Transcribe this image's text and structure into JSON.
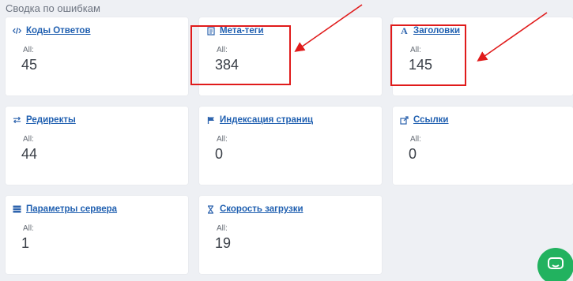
{
  "section_title": "Сводка по ошибкам",
  "cards": [
    {
      "title": "Коды Ответов",
      "all_label": "All:",
      "value": "45",
      "icon": "code-icon"
    },
    {
      "title": "Мета-теги",
      "all_label": "All:",
      "value": "384",
      "icon": "document-icon"
    },
    {
      "title": "Заголовки",
      "all_label": "All:",
      "value": "145",
      "icon": "heading-icon"
    },
    {
      "title": "Редиректы",
      "all_label": "All:",
      "value": "44",
      "icon": "redirect-arrows-icon"
    },
    {
      "title": "Индексация страниц",
      "all_label": "All:",
      "value": "0",
      "icon": "flag-icon"
    },
    {
      "title": "Ссылки",
      "all_label": "All:",
      "value": "0",
      "icon": "external-link-icon"
    },
    {
      "title": "Параметры сервера",
      "all_label": "All:",
      "value": "1",
      "icon": "server-icon"
    },
    {
      "title": "Скорость загрузки",
      "all_label": "All:",
      "value": "19",
      "icon": "hourglass-icon"
    }
  ],
  "colors": {
    "link": "#1f5fb0",
    "highlight": "#e01b1b",
    "chat_button": "#22b25f",
    "background": "#eef0f4"
  },
  "chat_button_icon": "chat-icon"
}
